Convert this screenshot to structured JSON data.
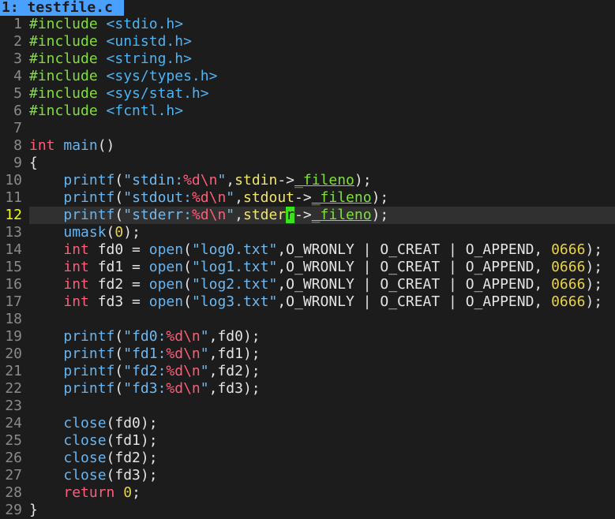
{
  "tab": {
    "index": "1:",
    "filename": "testfile.c"
  },
  "editor": {
    "current_line": 12,
    "lines": [
      {
        "n": "1",
        "tokens": [
          {
            "t": "#include",
            "c": "t-pre"
          },
          {
            "t": " "
          },
          {
            "t": "<stdio.h>",
            "c": "t-inc"
          }
        ]
      },
      {
        "n": "2",
        "tokens": [
          {
            "t": "#include",
            "c": "t-pre"
          },
          {
            "t": " "
          },
          {
            "t": "<unistd.h>",
            "c": "t-inc"
          }
        ]
      },
      {
        "n": "3",
        "tokens": [
          {
            "t": "#include",
            "c": "t-pre"
          },
          {
            "t": " "
          },
          {
            "t": "<string.h>",
            "c": "t-inc"
          }
        ]
      },
      {
        "n": "4",
        "tokens": [
          {
            "t": "#include",
            "c": "t-pre"
          },
          {
            "t": " "
          },
          {
            "t": "<sys/types.h>",
            "c": "t-inc"
          }
        ]
      },
      {
        "n": "5",
        "tokens": [
          {
            "t": "#include",
            "c": "t-pre"
          },
          {
            "t": " "
          },
          {
            "t": "<sys/stat.h>",
            "c": "t-inc"
          }
        ]
      },
      {
        "n": "6",
        "tokens": [
          {
            "t": "#include",
            "c": "t-pre"
          },
          {
            "t": " "
          },
          {
            "t": "<fcntl.h>",
            "c": "t-inc"
          }
        ]
      },
      {
        "n": "7",
        "tokens": []
      },
      {
        "n": "8",
        "tokens": [
          {
            "t": "int",
            "c": "t-kw"
          },
          {
            "t": " "
          },
          {
            "t": "main",
            "c": "t-fn"
          },
          {
            "t": "()"
          }
        ]
      },
      {
        "n": "9",
        "tokens": [
          {
            "t": "{"
          }
        ]
      },
      {
        "n": "10",
        "tokens": [
          {
            "t": "    "
          },
          {
            "t": "printf",
            "c": "t-fn"
          },
          {
            "t": "("
          },
          {
            "t": "\"stdin:",
            "c": "t-str"
          },
          {
            "t": "%d\\n",
            "c": "t-fmt"
          },
          {
            "t": "\"",
            "c": "t-str"
          },
          {
            "t": ","
          },
          {
            "t": "stdin",
            "c": "t-var"
          },
          {
            "t": "->"
          },
          {
            "t": "_fileno",
            "c": "t-mem"
          },
          {
            "t": ");"
          }
        ]
      },
      {
        "n": "11",
        "tokens": [
          {
            "t": "    "
          },
          {
            "t": "printf",
            "c": "t-fn"
          },
          {
            "t": "("
          },
          {
            "t": "\"stdout:",
            "c": "t-str"
          },
          {
            "t": "%d\\n",
            "c": "t-fmt"
          },
          {
            "t": "\"",
            "c": "t-str"
          },
          {
            "t": ","
          },
          {
            "t": "stdout",
            "c": "t-var"
          },
          {
            "t": "->"
          },
          {
            "t": "_fileno",
            "c": "t-mem"
          },
          {
            "t": ");"
          }
        ]
      },
      {
        "n": "12",
        "tokens": [
          {
            "t": "    "
          },
          {
            "t": "printf",
            "c": "t-fn"
          },
          {
            "t": "("
          },
          {
            "t": "\"stderr:",
            "c": "t-str"
          },
          {
            "t": "%d\\n",
            "c": "t-fmt"
          },
          {
            "t": "\"",
            "c": "t-str"
          },
          {
            "t": ","
          },
          {
            "t": "stder",
            "c": "t-var"
          },
          {
            "t": "r",
            "c": "cursor"
          },
          {
            "t": "->"
          },
          {
            "t": "_fileno",
            "c": "t-mem"
          },
          {
            "t": ");"
          }
        ]
      },
      {
        "n": "13",
        "tokens": [
          {
            "t": "    "
          },
          {
            "t": "umask",
            "c": "t-fn"
          },
          {
            "t": "("
          },
          {
            "t": "0",
            "c": "t-num"
          },
          {
            "t": ");"
          }
        ]
      },
      {
        "n": "14",
        "tokens": [
          {
            "t": "    "
          },
          {
            "t": "int",
            "c": "t-kw"
          },
          {
            "t": " fd0 = "
          },
          {
            "t": "open",
            "c": "t-fn"
          },
          {
            "t": "("
          },
          {
            "t": "\"log0.txt\"",
            "c": "t-str"
          },
          {
            "t": ",O_WRONLY | O_CREAT | O_APPEND, "
          },
          {
            "t": "0666",
            "c": "t-num"
          },
          {
            "t": ");"
          }
        ]
      },
      {
        "n": "15",
        "tokens": [
          {
            "t": "    "
          },
          {
            "t": "int",
            "c": "t-kw"
          },
          {
            "t": " fd1 = "
          },
          {
            "t": "open",
            "c": "t-fn"
          },
          {
            "t": "("
          },
          {
            "t": "\"log1.txt\"",
            "c": "t-str"
          },
          {
            "t": ",O_WRONLY | O_CREAT | O_APPEND, "
          },
          {
            "t": "0666",
            "c": "t-num"
          },
          {
            "t": ");"
          }
        ]
      },
      {
        "n": "16",
        "tokens": [
          {
            "t": "    "
          },
          {
            "t": "int",
            "c": "t-kw"
          },
          {
            "t": " fd2 = "
          },
          {
            "t": "open",
            "c": "t-fn"
          },
          {
            "t": "("
          },
          {
            "t": "\"log2.txt\"",
            "c": "t-str"
          },
          {
            "t": ",O_WRONLY | O_CREAT | O_APPEND, "
          },
          {
            "t": "0666",
            "c": "t-num"
          },
          {
            "t": ");"
          }
        ]
      },
      {
        "n": "17",
        "tokens": [
          {
            "t": "    "
          },
          {
            "t": "int",
            "c": "t-kw"
          },
          {
            "t": " fd3 = "
          },
          {
            "t": "open",
            "c": "t-fn"
          },
          {
            "t": "("
          },
          {
            "t": "\"log3.txt\"",
            "c": "t-str"
          },
          {
            "t": ",O_WRONLY | O_CREAT | O_APPEND, "
          },
          {
            "t": "0666",
            "c": "t-num"
          },
          {
            "t": ");"
          }
        ]
      },
      {
        "n": "18",
        "tokens": []
      },
      {
        "n": "19",
        "tokens": [
          {
            "t": "    "
          },
          {
            "t": "printf",
            "c": "t-fn"
          },
          {
            "t": "("
          },
          {
            "t": "\"fd0:",
            "c": "t-str"
          },
          {
            "t": "%d\\n",
            "c": "t-fmt"
          },
          {
            "t": "\"",
            "c": "t-str"
          },
          {
            "t": ",fd0);"
          }
        ]
      },
      {
        "n": "20",
        "tokens": [
          {
            "t": "    "
          },
          {
            "t": "printf",
            "c": "t-fn"
          },
          {
            "t": "("
          },
          {
            "t": "\"fd1:",
            "c": "t-str"
          },
          {
            "t": "%d\\n",
            "c": "t-fmt"
          },
          {
            "t": "\"",
            "c": "t-str"
          },
          {
            "t": ",fd1);"
          }
        ]
      },
      {
        "n": "21",
        "tokens": [
          {
            "t": "    "
          },
          {
            "t": "printf",
            "c": "t-fn"
          },
          {
            "t": "("
          },
          {
            "t": "\"fd2:",
            "c": "t-str"
          },
          {
            "t": "%d\\n",
            "c": "t-fmt"
          },
          {
            "t": "\"",
            "c": "t-str"
          },
          {
            "t": ",fd2);"
          }
        ]
      },
      {
        "n": "22",
        "tokens": [
          {
            "t": "    "
          },
          {
            "t": "printf",
            "c": "t-fn"
          },
          {
            "t": "("
          },
          {
            "t": "\"fd3:",
            "c": "t-str"
          },
          {
            "t": "%d\\n",
            "c": "t-fmt"
          },
          {
            "t": "\"",
            "c": "t-str"
          },
          {
            "t": ",fd3);"
          }
        ]
      },
      {
        "n": "23",
        "tokens": []
      },
      {
        "n": "24",
        "tokens": [
          {
            "t": "    "
          },
          {
            "t": "close",
            "c": "t-fn"
          },
          {
            "t": "(fd0);"
          }
        ]
      },
      {
        "n": "25",
        "tokens": [
          {
            "t": "    "
          },
          {
            "t": "close",
            "c": "t-fn"
          },
          {
            "t": "(fd1);"
          }
        ]
      },
      {
        "n": "26",
        "tokens": [
          {
            "t": "    "
          },
          {
            "t": "close",
            "c": "t-fn"
          },
          {
            "t": "(fd2);"
          }
        ]
      },
      {
        "n": "27",
        "tokens": [
          {
            "t": "    "
          },
          {
            "t": "close",
            "c": "t-fn"
          },
          {
            "t": "(fd3);"
          }
        ]
      },
      {
        "n": "28",
        "tokens": [
          {
            "t": "    "
          },
          {
            "t": "return",
            "c": "t-kw"
          },
          {
            "t": " "
          },
          {
            "t": "0",
            "c": "t-num"
          },
          {
            "t": ";"
          }
        ]
      },
      {
        "n": "29",
        "tokens": [
          {
            "t": "}"
          }
        ]
      }
    ]
  }
}
